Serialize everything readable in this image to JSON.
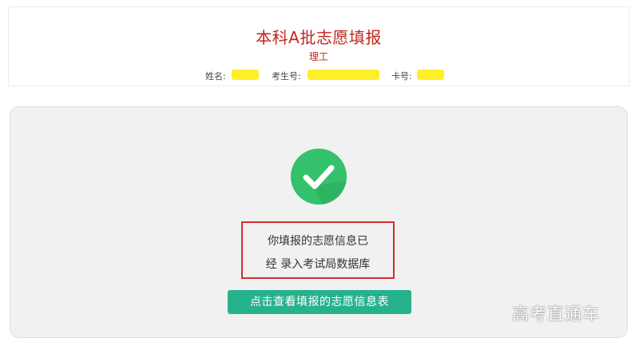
{
  "header": {
    "title": "本科A批志愿填报",
    "subtitle": "理工",
    "name_label": "姓名:",
    "name_value": "",
    "exam_no_label": "考生号:",
    "exam_no_value": "",
    "card_no_label": "卡号:",
    "card_no_value": "",
    "redaction_color": "#ffef2a"
  },
  "main": {
    "success_icon": "check-circle-icon",
    "success_color": "#33c16b",
    "message_line_1": "你填报的志愿信息已",
    "message_line_2": "经 录入考试局数据库",
    "highlight_border_color": "#d92b2b",
    "view_button_label": "点击查看填报的志愿信息表",
    "button_color": "#26b28d"
  },
  "watermark": {
    "text": "高考直通车"
  }
}
